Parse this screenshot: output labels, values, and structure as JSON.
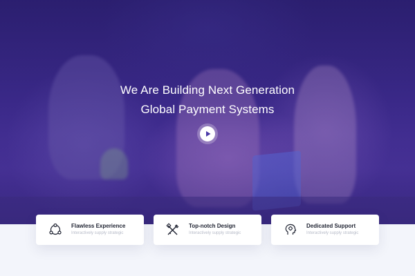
{
  "hero": {
    "title_line1": "We Are Building Next Generation",
    "title_line2": "Global Payment Systems",
    "play_icon": "play-icon",
    "overlay_color": "#3b2a86"
  },
  "features": [
    {
      "title": "Flawless Experience",
      "subtitle": "Interactively supply strategic",
      "icon": "users-network-icon"
    },
    {
      "title": "Top-notch Design",
      "subtitle": "Interactively supply strategic",
      "icon": "design-tools-icon"
    },
    {
      "title": "Dedicated Support",
      "subtitle": "Interactively supply strategic",
      "icon": "support-head-icon"
    }
  ],
  "colors": {
    "card_title": "#1d2130",
    "card_subtitle": "#b6bac7",
    "page_background": "#f3f5fb"
  }
}
